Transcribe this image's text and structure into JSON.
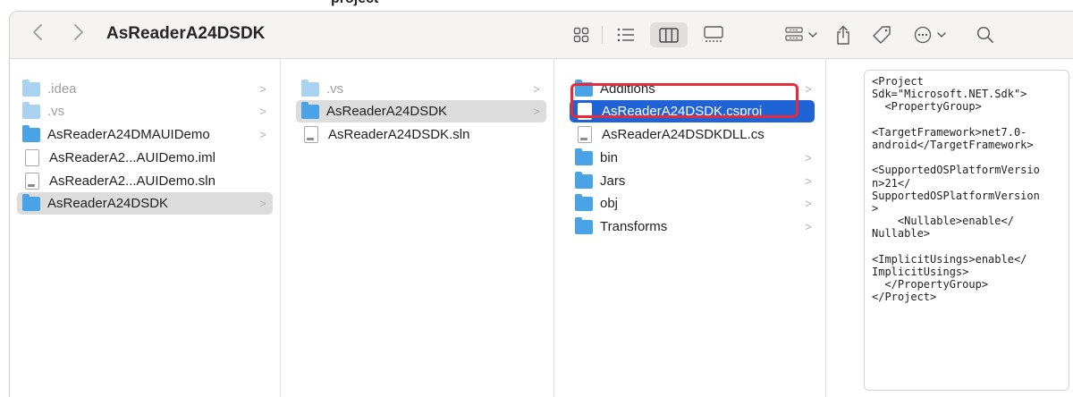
{
  "window": {
    "title": "AsReaderA24DSDK"
  },
  "top_crop_text": "project",
  "toolbar": {
    "back_icon": "chevron-left-icon",
    "forward_icon": "chevron-right-icon",
    "view_modes": [
      "icon-view-icon",
      "list-view-icon",
      "column-view-icon",
      "gallery-view-icon"
    ],
    "active_view": "column-view-icon",
    "group_icon": "group-icon",
    "share_icon": "share-icon",
    "tag_icon": "tag-icon",
    "more_icon": "more-icon",
    "search_icon": "search-icon"
  },
  "columns": [
    {
      "items": [
        {
          "label": ".idea",
          "type": "folder",
          "dim": true,
          "chevron": true
        },
        {
          "label": ".vs",
          "type": "folder",
          "dim": true,
          "chevron": true
        },
        {
          "label": "AsReaderA24DMAUIDemo",
          "type": "folder",
          "dim": false,
          "chevron": true
        },
        {
          "label": "AsReaderA2...AUIDemo.iml",
          "type": "file",
          "dim": false,
          "chevron": false
        },
        {
          "label": "AsReaderA2...AUIDemo.sln",
          "type": "file",
          "dim": false,
          "chevron": false
        },
        {
          "label": "AsReaderA24DSDK",
          "type": "folder",
          "dim": false,
          "chevron": true,
          "selected": "gray"
        }
      ]
    },
    {
      "items": [
        {
          "label": ".vs",
          "type": "folder",
          "dim": true,
          "chevron": true
        },
        {
          "label": "AsReaderA24DSDK",
          "type": "folder",
          "dim": false,
          "chevron": true,
          "selected": "gray"
        },
        {
          "label": "AsReaderA24DSDK.sln",
          "type": "file",
          "dim": false,
          "chevron": false
        }
      ]
    },
    {
      "items": [
        {
          "label": "Additions",
          "type": "folder",
          "dim": false,
          "chevron": true
        },
        {
          "label": "AsReaderA24DSDK.csproj",
          "type": "file",
          "dim": false,
          "chevron": false,
          "selected": "blue"
        },
        {
          "label": "AsReaderA24DSDKDLL.cs",
          "type": "file",
          "dim": false,
          "chevron": false
        },
        {
          "label": "bin",
          "type": "folder",
          "dim": false,
          "chevron": true
        },
        {
          "label": "Jars",
          "type": "folder",
          "dim": false,
          "chevron": true
        },
        {
          "label": "obj",
          "type": "folder",
          "dim": false,
          "chevron": true
        },
        {
          "label": "Transforms",
          "type": "folder",
          "dim": false,
          "chevron": true
        }
      ]
    }
  ],
  "preview": {
    "content": "<Project\nSdk=\"Microsoft.NET.Sdk\">\n  <PropertyGroup>\n\n<TargetFramework>net7.0-\nandroid</TargetFramework>\n\n<SupportedOSPlatformVersio\nn>21</\nSupportedOSPlatformVersion\n>\n    <Nullable>enable</\nNullable>\n\n<ImplicitUsings>enable</\nImplicitUsings>\n  </PropertyGroup>\n</Project>"
  },
  "colors": {
    "selection_blue": "#1f63d6",
    "selection_gray": "#dcdcdc",
    "folder_blue": "#4aa3e6",
    "highlight_red": "#e52a3a"
  }
}
